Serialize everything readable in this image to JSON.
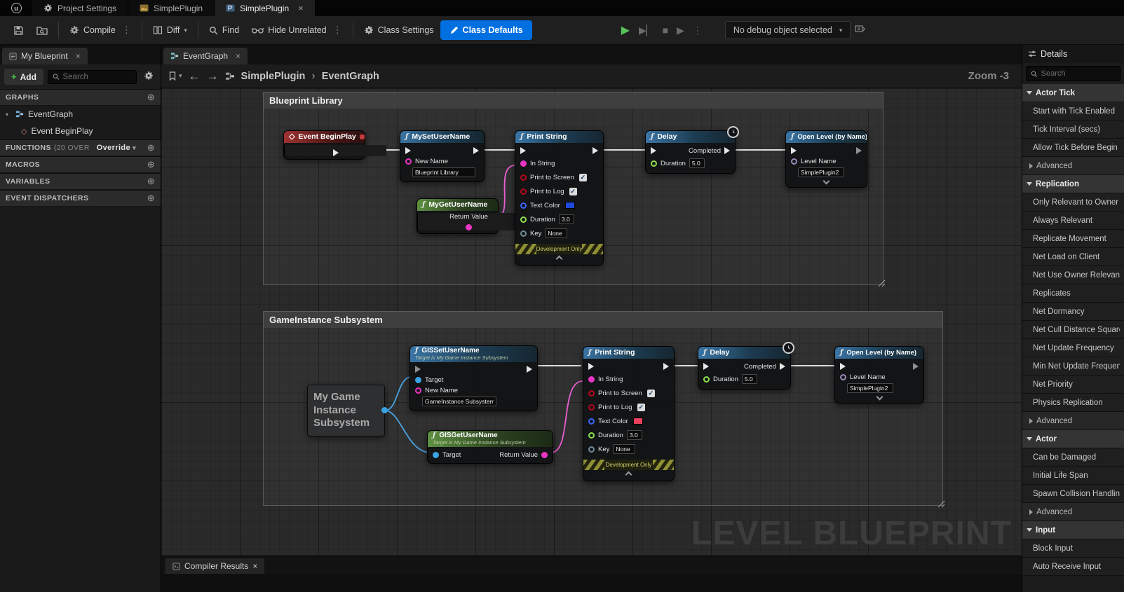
{
  "colors": {
    "accent_blue": "#0070e0",
    "play_green": "#58c15a",
    "exec_white": "#e6e6e6",
    "pin_string": "#ea35c5",
    "pin_bool": "#b3091c",
    "pin_float": "#8ce04b",
    "pin_object": "#3aa3e3",
    "pin_color": "#3b63ff",
    "swatch_blue": "#1e49d8",
    "swatch_red": "#e9415e",
    "wire_exec": "#dcdcdc",
    "wire_string": "#e95fd2",
    "wire_object": "#4aa3e0"
  },
  "titlebar": {
    "tabs": [
      {
        "label": "Project Settings"
      },
      {
        "label": "SimplePlugin"
      },
      {
        "label": "SimplePlugin"
      }
    ],
    "close": "×"
  },
  "toolbar": {
    "compile": "Compile",
    "diff": "Diff",
    "find": "Find",
    "hide_unrelated": "Hide Unrelated",
    "class_settings": "Class Settings",
    "class_defaults": "Class Defaults",
    "debug_object": "No debug object selected"
  },
  "my_blueprint": {
    "title": "My Blueprint",
    "add": "Add",
    "search_placeholder": "Search",
    "sections": {
      "graphs": "GRAPHS",
      "functions": "FUNCTIONS",
      "functions_count": "(20 OVER",
      "override": "Override",
      "macros": "MACROS",
      "variables": "VARIABLES",
      "event_dispatchers": "EVENT DISPATCHERS"
    },
    "items": {
      "eventgraph": "EventGraph",
      "event_beginplay": "Event BeginPlay"
    }
  },
  "graph": {
    "tab": "EventGraph",
    "breadcrumb": [
      "SimplePlugin",
      "EventGraph"
    ],
    "zoom": "Zoom -3",
    "watermark": "LEVEL BLUEPRINT",
    "comments": [
      {
        "title": "Blueprint Library"
      },
      {
        "title": "GameInstance Subsystem"
      }
    ],
    "nodes": {
      "begin_play": {
        "title": "Event BeginPlay"
      },
      "my_set": {
        "title": "MySetUserName",
        "new_name_label": "New Name",
        "new_name_value": "Blueprint Library"
      },
      "my_get": {
        "title": "MyGetUserName",
        "return_label": "Return Value"
      },
      "print1": {
        "title": "Print String",
        "in_string": "In String",
        "print_screen": "Print to Screen",
        "print_log": "Print to Log",
        "text_color": "Text Color",
        "duration": "Duration",
        "duration_value": "3.0",
        "key": "Key",
        "key_value": "None",
        "footer": "Development Only"
      },
      "delay1": {
        "title": "Delay",
        "completed": "Completed",
        "duration": "Duration",
        "duration_value": "5.0"
      },
      "open1": {
        "title": "Open Level (by Name)",
        "level_name": "Level Name",
        "level_value": "SimplePlugin2"
      },
      "game_instance": {
        "title": "My Game Instance Subsystem"
      },
      "gis_set": {
        "title": "GISSetUserName",
        "subtitle": "Target is My Game Instance Subsystem",
        "target": "Target",
        "new_name_label": "New Name",
        "new_name_value": "GameInstance Subsystem"
      },
      "gis_get": {
        "title": "GISGetUserName",
        "subtitle": "Target is My Game Instance Subsystem",
        "target": "Target",
        "return_label": "Return Value"
      },
      "print2": {
        "title": "Print String",
        "in_string": "In String",
        "print_screen": "Print to Screen",
        "print_log": "Print to Log",
        "text_color": "Text Color",
        "duration": "Duration",
        "duration_value": "3.0",
        "key": "Key",
        "key_value": "None",
        "footer": "Development Only"
      },
      "delay2": {
        "title": "Delay",
        "completed": "Completed",
        "duration": "Duration",
        "duration_value": "5.0"
      },
      "open2": {
        "title": "Open Level (by Name)",
        "level_name": "Level Name",
        "level_value": "SimplePlugin2"
      }
    }
  },
  "compiler": {
    "tab": "Compiler Results"
  },
  "details": {
    "title": "Details",
    "search_placeholder": "Search",
    "rows": [
      {
        "type": "category",
        "label": "Actor Tick"
      },
      {
        "type": "prop",
        "label": "Start with Tick Enabled"
      },
      {
        "type": "prop",
        "label": "Tick Interval (secs)"
      },
      {
        "type": "prop",
        "label": "Allow Tick Before Begin Play"
      },
      {
        "type": "advanced",
        "label": "Advanced"
      },
      {
        "type": "category",
        "label": "Replication"
      },
      {
        "type": "prop",
        "label": "Only Relevant to Owner"
      },
      {
        "type": "prop",
        "label": "Always Relevant"
      },
      {
        "type": "prop",
        "label": "Replicate Movement"
      },
      {
        "type": "prop",
        "label": "Net Load on Client"
      },
      {
        "type": "prop",
        "label": "Net Use Owner Relevancy"
      },
      {
        "type": "prop",
        "label": "Replicates"
      },
      {
        "type": "prop",
        "label": "Net Dormancy"
      },
      {
        "type": "prop",
        "label": "Net Cull Distance Squared"
      },
      {
        "type": "prop",
        "label": "Net Update Frequency"
      },
      {
        "type": "prop",
        "label": "Min Net Update Frequency"
      },
      {
        "type": "prop",
        "label": "Net Priority"
      },
      {
        "type": "prop",
        "label": "Physics Replication"
      },
      {
        "type": "advanced",
        "label": "Advanced"
      },
      {
        "type": "category",
        "label": "Actor"
      },
      {
        "type": "prop",
        "label": "Can be Damaged"
      },
      {
        "type": "prop",
        "label": "Initial Life Span"
      },
      {
        "type": "prop",
        "label": "Spawn Collision Handling Method"
      },
      {
        "type": "advanced",
        "label": "Advanced"
      },
      {
        "type": "category",
        "label": "Input"
      },
      {
        "type": "prop",
        "label": "Block Input"
      },
      {
        "type": "prop",
        "label": "Auto Receive Input"
      }
    ]
  }
}
